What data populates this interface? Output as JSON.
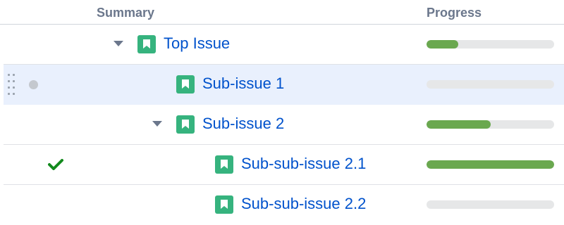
{
  "header": {
    "summary_label": "Summary",
    "progress_label": "Progress"
  },
  "rows": [
    {
      "title": "Top Issue",
      "expanded": true,
      "progress": 0.25
    },
    {
      "title": "Sub-issue 1",
      "selected": true,
      "status": "grey-dot",
      "progress": 0.0
    },
    {
      "title": "Sub-issue 2",
      "expanded": true,
      "progress": 0.5
    },
    {
      "title": "Sub-sub-issue 2.1",
      "status": "checkmark",
      "progress": 1.0
    },
    {
      "title": "Sub-sub-issue 2.2",
      "progress": 0.0
    }
  ],
  "colors": {
    "link": "#0052cc",
    "issue_icon": "#36b37e",
    "progress_fill": "#6aa84f",
    "progress_track": "#e6e7e8",
    "selected_row": "#e9f0fd",
    "check": "#138a1e"
  },
  "icons": {
    "issue": "bookmark-icon",
    "expand": "caret-down-icon",
    "drag": "drag-handle-icon",
    "done": "checkmark-icon",
    "status": "status-dot-icon"
  }
}
